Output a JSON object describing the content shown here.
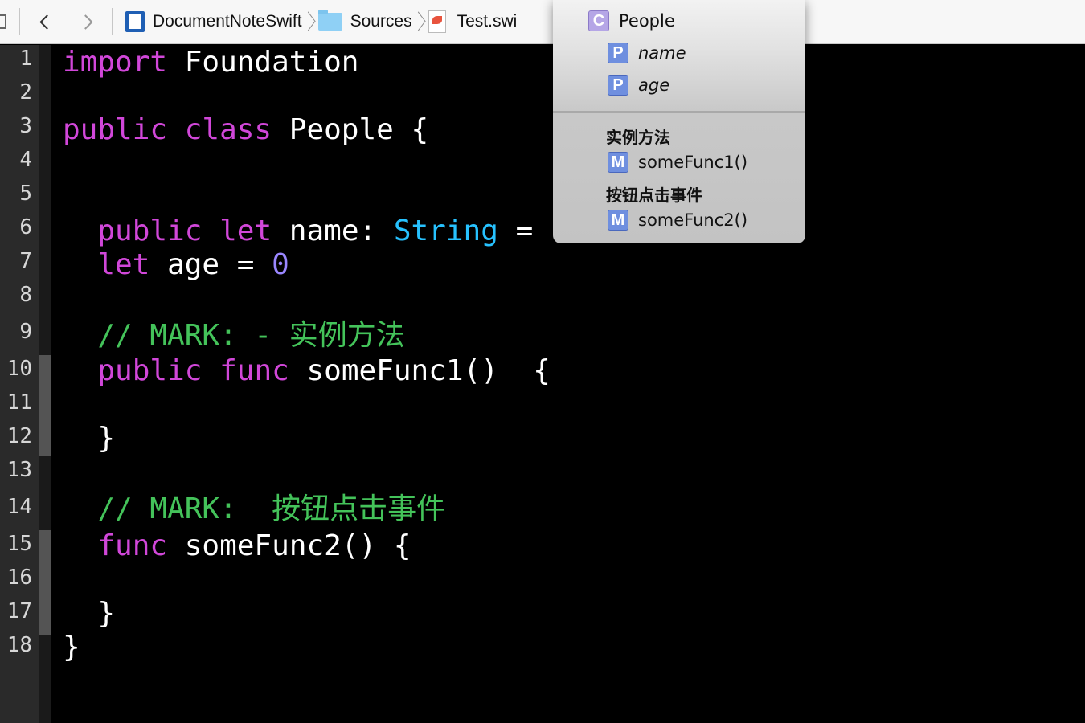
{
  "jumpbar": {
    "crumbs": [
      "DocumentNoteSwift",
      "Sources",
      "Test.swi"
    ]
  },
  "editor": {
    "line_numbers": [
      "1",
      "2",
      "3",
      "4",
      "5",
      "6",
      "7",
      "8",
      "9",
      "10",
      "11",
      "12",
      "13",
      "14",
      "15",
      "16",
      "17",
      "18"
    ],
    "lines": {
      "l1": {
        "kw": "import",
        "rest": " Foundation"
      },
      "l3": {
        "kw1": "public",
        "kw2": "class",
        "rest": " People {"
      },
      "l6": {
        "kw1": "public",
        "kw2": "let",
        "mid": " name: ",
        "type": "String",
        "rest": " ="
      },
      "l7": {
        "kw": "let",
        "mid": " age = ",
        "num": "0"
      },
      "l9": {
        "comment": "// MARK: - 实例方法"
      },
      "l10": {
        "kw1": "public",
        "kw2": "func",
        "rest": " someFunc1()  {"
      },
      "l12": {
        "text": "}"
      },
      "l14": {
        "comment": "// MARK:  按钮点击事件"
      },
      "l15": {
        "kw": "func",
        "rest": " someFunc2() {"
      },
      "l17": {
        "text": "}"
      },
      "l18": {
        "text": "}"
      }
    }
  },
  "symbol_popup": {
    "class_item": {
      "badge": "C",
      "label": "People"
    },
    "properties": [
      {
        "badge": "P",
        "label": "name"
      },
      {
        "badge": "P",
        "label": "age"
      }
    ],
    "sections": [
      {
        "heading": "实例方法",
        "items": [
          {
            "badge": "M",
            "label": "someFunc1()"
          }
        ]
      },
      {
        "heading": "按钮点击事件",
        "items": [
          {
            "badge": "M",
            "label": "someFunc2()"
          }
        ]
      }
    ]
  },
  "colors": {
    "keyword": "#d147d9",
    "type": "#27c2ff",
    "number": "#9a86ff",
    "comment": "#44c35a",
    "background": "#000000"
  },
  "icons": [
    "related-items-icon",
    "chevron-left-icon",
    "chevron-right-icon",
    "xcode-project-icon",
    "folder-icon",
    "swift-file-icon"
  ]
}
